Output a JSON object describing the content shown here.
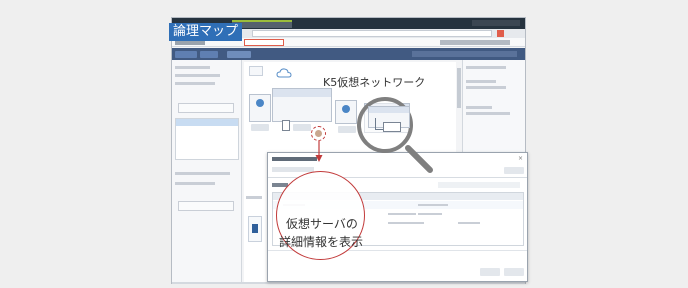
{
  "callout_map": {
    "text": "論理マップ"
  },
  "main_title": {
    "text": "K5仮想ネットワーク"
  },
  "callout_detail": {
    "line1": "仮想サーバの",
    "line2": "詳細情報を表示"
  },
  "colors": {
    "titlebar": "#26333f",
    "accent": "#3b6db3",
    "red": "#c23b3b",
    "tab_active": "#e05d4b",
    "mag": "#7f7f7f"
  },
  "icons": [
    "magnifier-icon",
    "cloud-icon",
    "server-icon",
    "arrow-down-icon",
    "click-target-icon",
    "close-icon"
  ]
}
